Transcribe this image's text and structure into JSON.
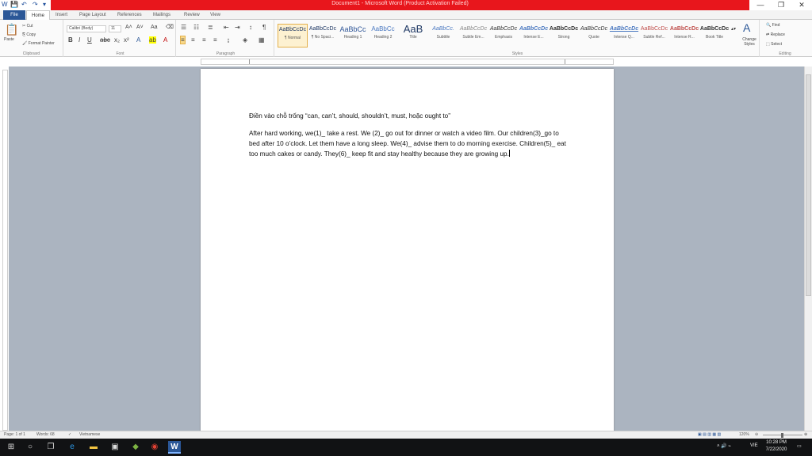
{
  "window": {
    "title": "Document1 - Microsoft Word (Product Activation Failed)",
    "controls": {
      "minimize": "—",
      "restore": "❐",
      "close": "✕"
    }
  },
  "qat": {
    "save": "💾",
    "undo": "↶",
    "redo": "↷",
    "customize": "▾"
  },
  "tabs": [
    "File",
    "Home",
    "Insert",
    "Page Layout",
    "References",
    "Mailings",
    "Review",
    "View"
  ],
  "ribbon": {
    "clipboard": {
      "paste": "Paste",
      "cut": "Cut",
      "copy": "Copy",
      "format_painter": "Format Painter",
      "label": "Clipboard"
    },
    "font": {
      "name": "Calibri (Body)",
      "size": "11",
      "label": "Font"
    },
    "paragraph": {
      "label": "Paragraph"
    },
    "styles": {
      "label": "Styles",
      "items": [
        {
          "preview": "AaBbCcDc",
          "name": "¶ Normal"
        },
        {
          "preview": "AaBbCcDc",
          "name": "¶ No Spaci..."
        },
        {
          "preview": "AaBbCc",
          "name": "Heading 1"
        },
        {
          "preview": "AaBbCc",
          "name": "Heading 2"
        },
        {
          "preview": "AaB",
          "name": "Title"
        },
        {
          "preview": "AaBbCc.",
          "name": "Subtitle"
        },
        {
          "preview": "AaBbCcDc",
          "name": "Subtle Em..."
        },
        {
          "preview": "AaBbCcDc",
          "name": "Emphasis"
        },
        {
          "preview": "AaBbCcDc",
          "name": "Intense E..."
        },
        {
          "preview": "AaBbCcDc",
          "name": "Strong"
        },
        {
          "preview": "AaBbCcDc",
          "name": "Quote"
        },
        {
          "preview": "AaBbCcDc",
          "name": "Intense Q..."
        },
        {
          "preview": "AaBbCcDc",
          "name": "Subtle Ref..."
        },
        {
          "preview": "AaBbCcDc",
          "name": "Intense R..."
        },
        {
          "preview": "AaBbCcDc",
          "name": "Book Title"
        }
      ],
      "change_styles": "Change Styles"
    },
    "editing": {
      "find": "Find",
      "replace": "Replace",
      "select": "Select",
      "label": "Editing"
    }
  },
  "document": {
    "line1": "Điền vào chỗ trống “can, can’t, should, shouldn’t, must, hoặc ought to”",
    "paragraph": "After hard working, we(1)_ take a rest. We (2)_ go out for dinner or watch a video film. Our children(3)_go to bed after 10 o’clock. Let them have a long sleep. We(4)_ advise them to do morning exercise. Children(5)_ eat too much cakes or candy. They(6)_ keep fit and stay healthy because they are growing up."
  },
  "status": {
    "page": "Page: 1 of 1",
    "words": "Words: 68",
    "language": "Vietnamese",
    "zoom": "120%"
  },
  "taskbar": {
    "time": "10:28 PM",
    "date": "7/22/2020",
    "lang": "VIE"
  }
}
